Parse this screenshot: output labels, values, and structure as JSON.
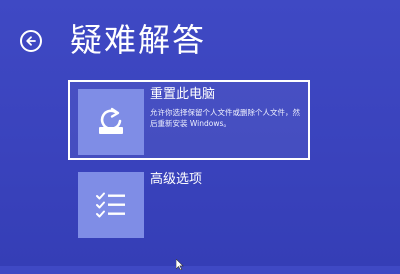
{
  "page": {
    "title": "疑难解答",
    "back_icon": "back-arrow-circle-icon"
  },
  "options": [
    {
      "title": "重置此电脑",
      "description": "允许你选择保留个人文件或删除个人文件，然后重新安装 Windows。",
      "icon": "reset-pc-icon",
      "selected": true
    },
    {
      "title": "高级选项",
      "icon": "checklist-icon",
      "selected": false
    }
  ],
  "colors": {
    "background": "#3a43bd",
    "tile": "#7f8de6",
    "text": "#ffffff"
  }
}
